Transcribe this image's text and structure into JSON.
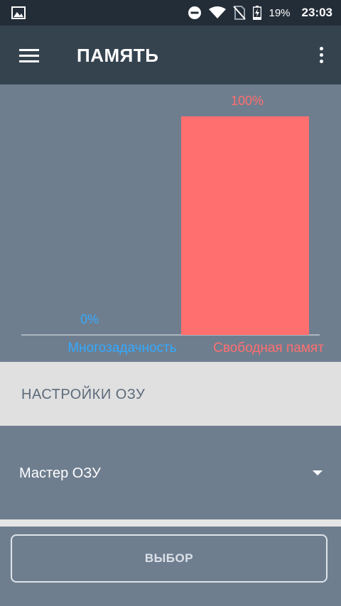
{
  "status_bar": {
    "battery_percent": "19%",
    "time": "23:03",
    "icons": [
      "image-icon",
      "do-not-disturb-icon",
      "wifi-icon",
      "no-sim-icon",
      "battery-charging-icon"
    ]
  },
  "app_bar": {
    "title": "ПАМЯТЬ",
    "menu_icon": "hamburger-menu-icon",
    "more_icon": "more-vertical-icon"
  },
  "chart_data": {
    "type": "bar",
    "categories": [
      "Многозадачность",
      "Свободная памят"
    ],
    "values": [
      0,
      100
    ],
    "value_labels": [
      "0%",
      "100%"
    ],
    "colors": [
      "#33aaff",
      "#ff6f6f"
    ],
    "ylim": [
      0,
      100
    ],
    "grid": false,
    "legend": "none"
  },
  "settings": {
    "header": "НАСТРОЙКИ ОЗУ",
    "dropdown_value": "Мастер ОЗУ"
  },
  "actions": {
    "choose_label": "ВЫБОР"
  }
}
